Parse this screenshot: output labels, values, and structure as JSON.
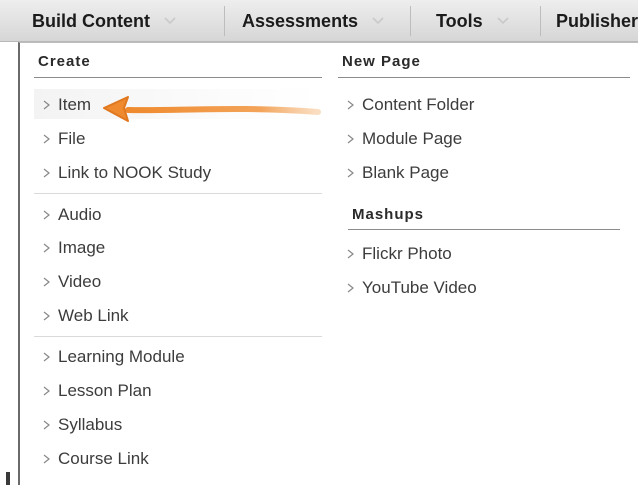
{
  "tabs": [
    {
      "label": "Build Content"
    },
    {
      "label": "Assessments"
    },
    {
      "label": "Tools"
    },
    {
      "label": "Publisher"
    }
  ],
  "create": {
    "header": "Create",
    "items": [
      "Item",
      "File",
      "Link to NOOK Study",
      "Audio",
      "Image",
      "Video",
      "Web Link",
      "Learning Module",
      "Lesson Plan",
      "Syllabus",
      "Course Link"
    ]
  },
  "new_page": {
    "header": "New Page",
    "items": [
      "Content Folder",
      "Module Page",
      "Blank Page"
    ]
  },
  "mashups": {
    "header": "Mashups",
    "items": [
      "Flickr Photo",
      "YouTube Video"
    ]
  },
  "colors": {
    "arrow": "#ef8a2e",
    "tab_text": "#1b1b1b",
    "item_text": "#3c3c3c"
  },
  "icons": {
    "tab_dropdown": "chevron-down-icon",
    "menu_item": "caret-right-icon",
    "annotation": "orange-arrow-icon"
  }
}
